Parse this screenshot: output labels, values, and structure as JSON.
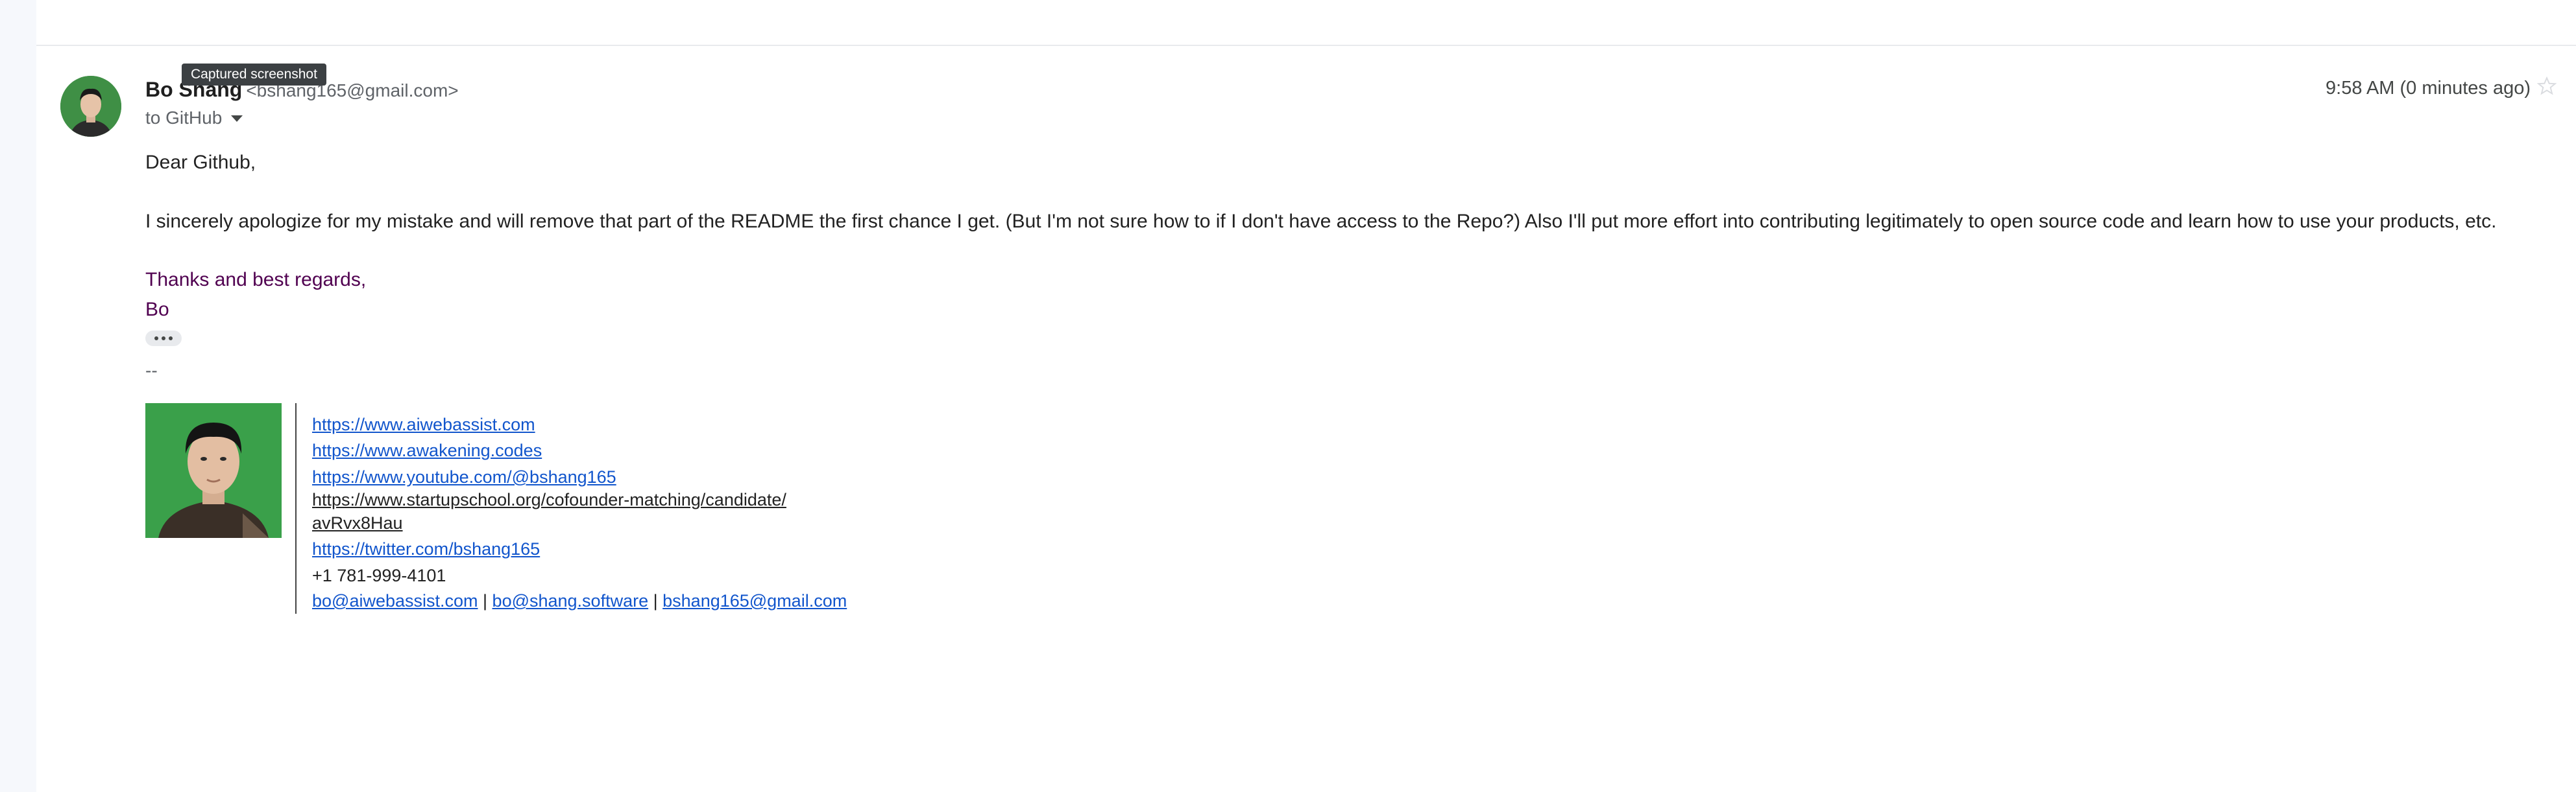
{
  "tooltip": "Captured screenshot",
  "sender": {
    "name": "Bo Shang",
    "email": "<bshang165@gmail.com>"
  },
  "recipient": "to GitHub",
  "timestamp": "9:58 AM (0 minutes ago)",
  "body": {
    "greeting": "Dear Github,",
    "paragraph": "I sincerely apologize for my mistake and will remove that part of the README the first chance I get. (But I'm not sure how to if I don't have access to the Repo?) Also I'll put more effort into contributing legitimately to open source code and learn how to use your products, etc.",
    "closing": "Thanks and best regards,",
    "signoff": "Bo"
  },
  "signature": {
    "separator": "--",
    "links": [
      "https://www.aiwebassist.com",
      "https://www.awakening.codes",
      "https://www.youtube.com/@bshang165"
    ],
    "startup_line1": "https://www.startupschool.org/cofounder-matching/candidate/",
    "startup_line2": "avRvx8Hau ",
    "twitter": "https://twitter.com/bshang165",
    "phone": "+1 781-999-4101",
    "email1": " bo@aiwebassist.com",
    "sep1": " | ",
    "email2": "bo@shang.software",
    "sep2": " | ",
    "email3": "bshang165@gmail.com"
  },
  "icons": {
    "star": "star-icon",
    "more": "more-dots-icon",
    "caret": "chevron-down-icon"
  },
  "colors": {
    "link": "#1155cc",
    "quoted_text": "#500050",
    "sidebar_bg": "#f6f8fc"
  }
}
